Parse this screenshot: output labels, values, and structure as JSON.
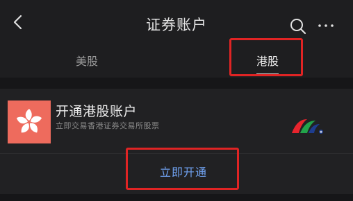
{
  "header": {
    "title": "证券账户"
  },
  "tabs": [
    {
      "label": "美股",
      "active": false
    },
    {
      "label": "港股",
      "active": true
    }
  ],
  "card": {
    "title": "开通港股账户",
    "subtitle": "立即交易香港证券交易所股票",
    "action_label": "立即开通"
  },
  "colors": {
    "background": "#1c1c1e",
    "action_text": "#6fa0ee",
    "flag_red": "#ee6b5d",
    "highlight": "#e02424"
  },
  "icons": [
    "back-arrow-icon",
    "search-icon",
    "more-icon",
    "hong-kong-flag-icon"
  ]
}
